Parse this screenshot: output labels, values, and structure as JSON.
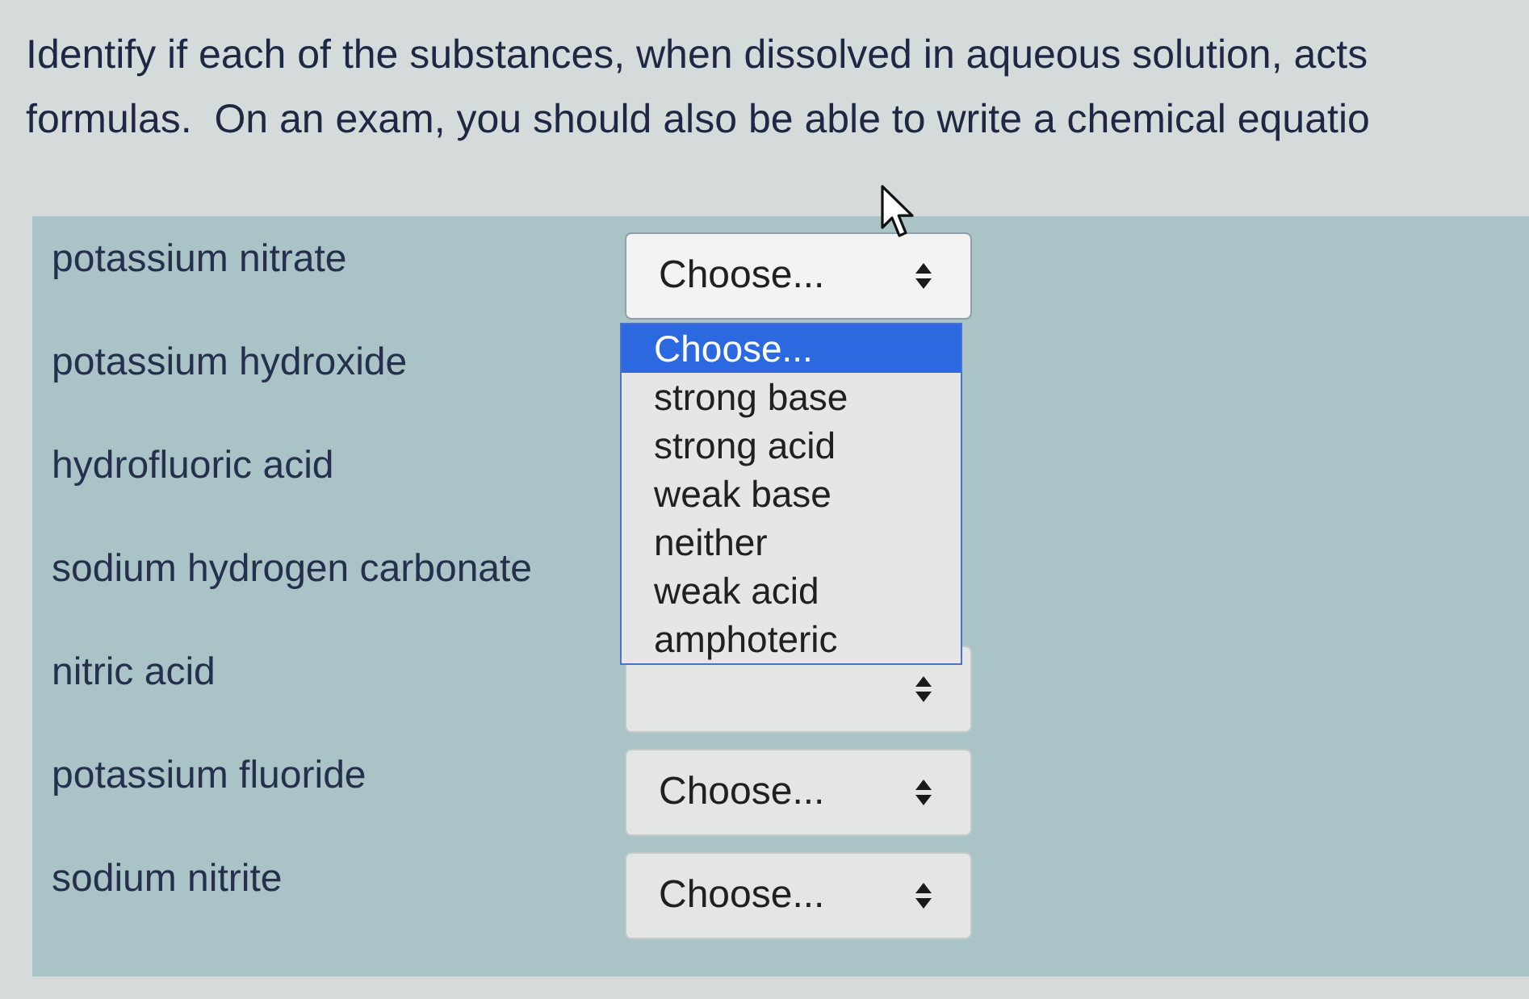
{
  "instructions": [
    "Identify if each of the substances, when dissolved in aqueous solution, acts",
    "formulas.  On an exam, you should also be able to write a chemical equatio"
  ],
  "items": [
    {
      "label": "potassium nitrate",
      "dropdown": {
        "value": "Choose...",
        "expanded": true,
        "options": [
          {
            "label": "Choose...",
            "selected": true
          },
          {
            "label": "strong base",
            "selected": false
          },
          {
            "label": "strong acid",
            "selected": false
          },
          {
            "label": "weak base",
            "selected": false
          },
          {
            "label": "neither",
            "selected": false
          },
          {
            "label": "weak acid",
            "selected": false
          },
          {
            "label": "amphoteric",
            "selected": false
          }
        ]
      }
    },
    {
      "label": "potassium hydroxide"
    },
    {
      "label": "hydrofluoric acid"
    },
    {
      "label": "sodium hydrogen carbonate"
    },
    {
      "label": "nitric acid",
      "dropdown": {
        "expanded": false
      }
    },
    {
      "label": "potassium fluoride",
      "dropdown": {
        "value": "Choose...",
        "expanded": false
      }
    },
    {
      "label": "sodium nitrite",
      "dropdown": {
        "value": "Choose...",
        "expanded": false
      }
    }
  ]
}
